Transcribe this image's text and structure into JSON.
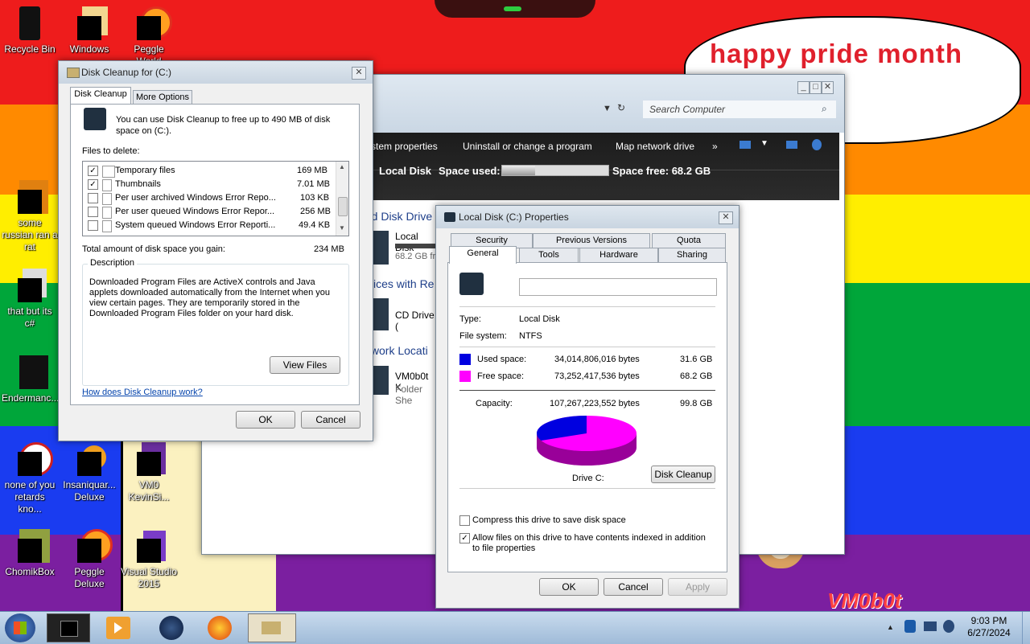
{
  "desktop": {
    "banner_text": "happy pride month",
    "watermark": "VM0b0t",
    "icons": [
      {
        "label": "Recycle Bin"
      },
      {
        "label": "Windows"
      },
      {
        "label": "Peggle World"
      },
      {
        "label": "some russian ran a rat"
      },
      {
        "label": "that but its c#"
      },
      {
        "label": "Endermanc..."
      },
      {
        "label": "none of you retards kno..."
      },
      {
        "label": "Insaniquar... Deluxe"
      },
      {
        "label": "VM0 KevinSi..."
      },
      {
        "label": "ChomikBox"
      },
      {
        "label": "Peggle Deluxe"
      },
      {
        "label": "Visual Studio 2015"
      }
    ]
  },
  "explorer": {
    "search_placeholder": "Search Computer",
    "toolbar": [
      "stem properties",
      "Uninstall or change a program",
      "Map network drive",
      "»"
    ],
    "status_drive": "Local Disk",
    "space_used_label": "Space used:",
    "space_free": "Space free: 68.2 GB",
    "sections": [
      "rd Disk Drive",
      "vices with Re",
      "twork Locati"
    ],
    "items": [
      {
        "name": "Local Disk",
        "sub": "68.2 GB fr"
      },
      {
        "name": "CD Drive (",
        "sub": ""
      },
      {
        "name": "VM0b0t K",
        "sub": "Folder She"
      }
    ]
  },
  "cleanup": {
    "title": "Disk Cleanup for  (C:)",
    "tabs": [
      "Disk Cleanup",
      "More Options"
    ],
    "intro": "You can use Disk Cleanup to free up to 490 MB of disk space on  (C:).",
    "files_label": "Files to delete:",
    "files": [
      {
        "name": "Temporary files",
        "size": "169 MB",
        "checked": true
      },
      {
        "name": "Thumbnails",
        "size": "7.01 MB",
        "checked": true
      },
      {
        "name": "Per user archived Windows Error Repo...",
        "size": "103 KB",
        "checked": false
      },
      {
        "name": "Per user queued Windows Error Repor...",
        "size": "256 MB",
        "checked": false
      },
      {
        "name": "System queued Windows Error Reporti...",
        "size": "49.4 KB",
        "checked": false
      }
    ],
    "total_label": "Total amount of disk space you gain:",
    "total_value": "234 MB",
    "description_label": "Description",
    "description": "Downloaded Program Files are ActiveX controls and Java applets downloaded automatically from the Internet when you view certain pages. They are temporarily stored in the Downloaded Program Files folder on your hard disk.",
    "view_files": "View Files",
    "help_link": "How does Disk Cleanup work?",
    "ok": "OK",
    "cancel": "Cancel"
  },
  "props": {
    "title": "Local Disk (C:) Properties",
    "tabs_top": [
      "Security",
      "Previous Versions",
      "Quota"
    ],
    "tabs_bottom": [
      "General",
      "Tools",
      "Hardware",
      "Sharing"
    ],
    "type_label": "Type:",
    "type_value": "Local Disk",
    "fs_label": "File system:",
    "fs_value": "NTFS",
    "used_label": "Used space:",
    "used_bytes": "34,014,806,016 bytes",
    "used_gb": "31.6 GB",
    "free_label": "Free space:",
    "free_bytes": "73,252,417,536 bytes",
    "free_gb": "68.2 GB",
    "capacity_label": "Capacity:",
    "capacity_bytes": "107,267,223,552 bytes",
    "capacity_gb": "99.8 GB",
    "used_fraction": 0.317,
    "used_color": "#0000e0",
    "free_color": "#ff00ff",
    "drive_label": "Drive C:",
    "disk_cleanup": "Disk Cleanup",
    "compress": "Compress this drive to save disk space",
    "index": "Allow files on this drive to have contents indexed in addition to file properties",
    "ok": "OK",
    "cancel": "Cancel",
    "apply": "Apply"
  },
  "taskbar": {
    "time": "9:03 PM",
    "date": "6/27/2024"
  }
}
